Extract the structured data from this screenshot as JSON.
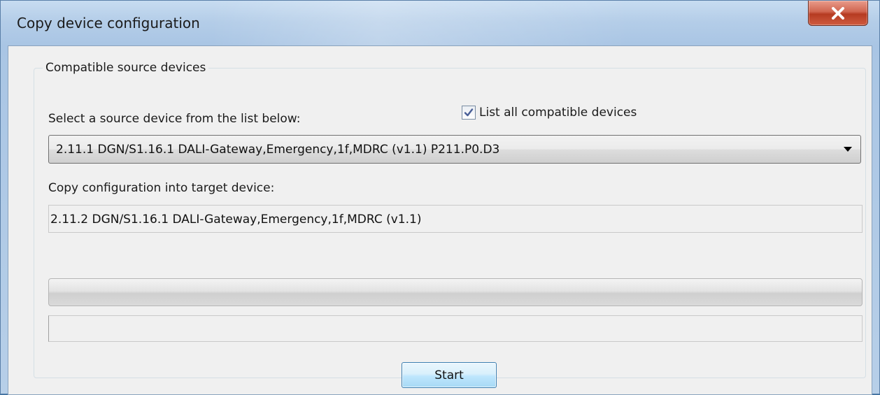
{
  "window": {
    "title": "Copy device configuration",
    "close_label": "X"
  },
  "group": {
    "label": "Compatible source devices",
    "source_prompt": "Select a source device from the list below:",
    "list_all": {
      "label": "List all compatible devices",
      "checked": true
    },
    "source_device": {
      "selected": "2.11.1 DGN/S1.16.1 DALI-Gateway,Emergency,1f,MDRC (v1.1) P211.P0.D3"
    },
    "target_prompt": "Copy configuration into target device:",
    "target_device": "2.11.2 DGN/S1.16.1 DALI-Gateway,Emergency,1f,MDRC (v1.1)",
    "progress": 0,
    "status_text": "",
    "start_label": "Start"
  },
  "colors": {
    "close_button": "#c8523a",
    "start_button_border": "#3c7fb1",
    "progress_fill": "#06b025"
  }
}
